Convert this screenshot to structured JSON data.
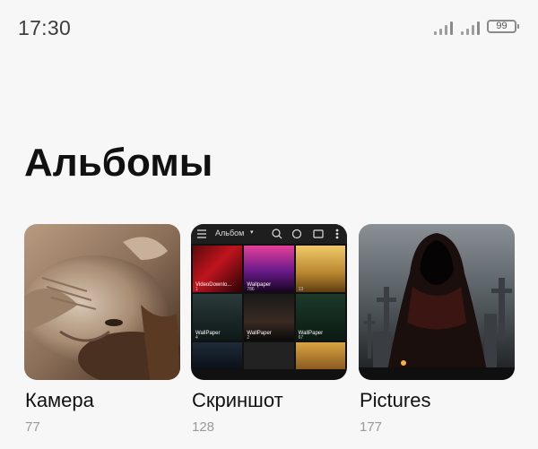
{
  "status_bar": {
    "time": "17:30",
    "battery": "99"
  },
  "page": {
    "title": "Альбомы"
  },
  "albums": [
    {
      "name": "Камера",
      "count": "77",
      "thumbnail": "cat-photo"
    },
    {
      "name": "Скриншот",
      "count": "128",
      "thumbnail": "gallery-screenshot"
    },
    {
      "name": "Pictures",
      "count": "177",
      "thumbnail": "hooded-figure-cemetery"
    }
  ],
  "screenshot_thumb": {
    "toolbar_title": "Альбом",
    "cells": [
      {
        "label": "VideoDownlo...",
        "count": "1"
      },
      {
        "label": "Wallpaper",
        "count": "786"
      },
      {
        "label": "",
        "count": "13"
      },
      {
        "label": "WallPaper",
        "count": "4"
      },
      {
        "label": "WallPaper",
        "count": "2"
      },
      {
        "label": "WallPaper",
        "count": "67"
      },
      {
        "label": "",
        "count": ""
      },
      {
        "label": "",
        "count": ""
      },
      {
        "label": "",
        "count": ""
      }
    ]
  },
  "colors": {
    "background": "#f7f7f7",
    "title": "#111111",
    "count": "#9a9a9a"
  }
}
